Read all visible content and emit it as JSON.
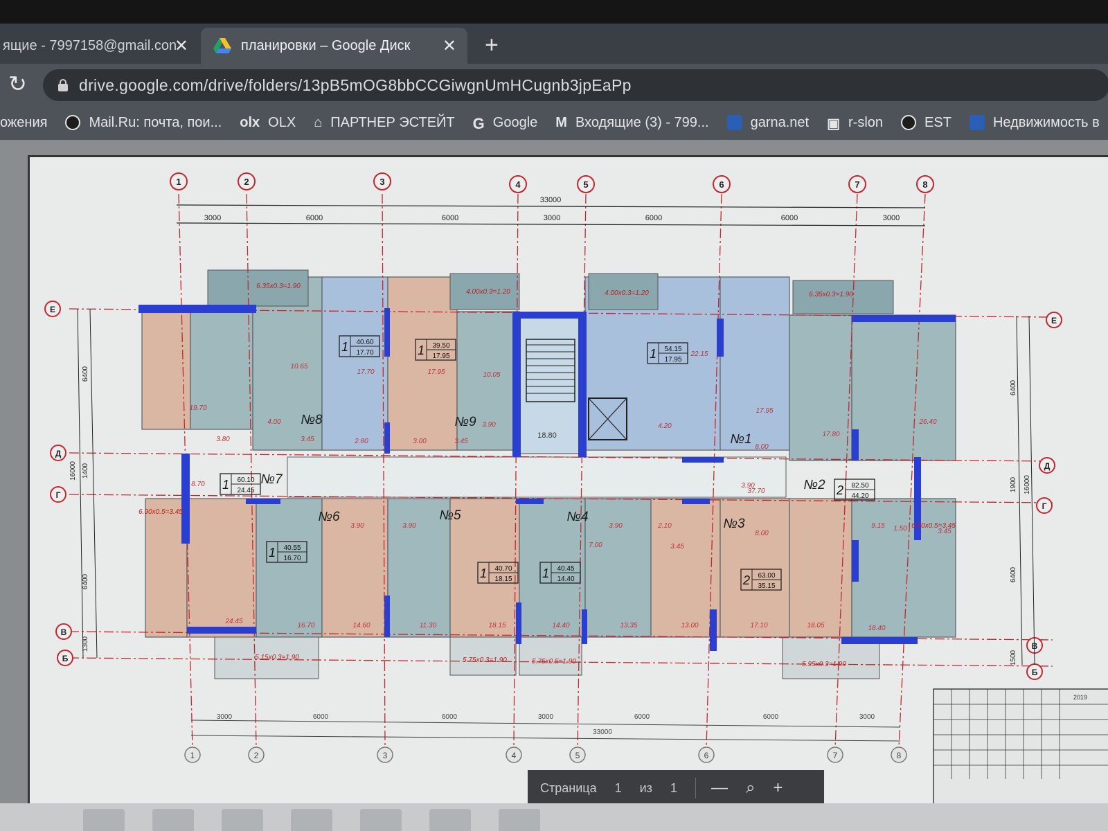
{
  "browser": {
    "tabs": [
      {
        "title": "ящие - 7997158@gmail.con",
        "active": false
      },
      {
        "title": "планировки – Google Диск",
        "active": true
      }
    ],
    "new_tab": "+",
    "close_glyph": "✕",
    "reload_glyph": "↻",
    "url": "drive.google.com/drive/folders/13pB5mOG8bbCCGiwgnUmHCugnb3jpEaPp"
  },
  "bookmarks": [
    {
      "label": "ожения",
      "icon": "none"
    },
    {
      "label": "Mail.Ru: почта, пои...",
      "icon": "globe-icon"
    },
    {
      "label": "OLX",
      "icon": "olx-icon"
    },
    {
      "label": "ПАРТНЕР ЭСТЕЙТ",
      "icon": "house-icon"
    },
    {
      "label": "Google",
      "icon": "google-icon"
    },
    {
      "label": "Входящие (3) - 799...",
      "icon": "gmail-icon"
    },
    {
      "label": "garna.net",
      "icon": "garna-icon"
    },
    {
      "label": "r-slon",
      "icon": "rslon-icon"
    },
    {
      "label": "EST",
      "icon": "globe-icon"
    },
    {
      "label": "Недвижимость в",
      "icon": "realty-icon"
    }
  ],
  "pdf_controls": {
    "page_label": "Страница",
    "current_page": "1",
    "of_label": "из",
    "total_pages": "1",
    "zoom_out": "—",
    "zoom_icon": "magnifier-icon",
    "zoom_in": "+"
  },
  "floorplan": {
    "axes_top": [
      "1",
      "2",
      "3",
      "4",
      "5",
      "6",
      "7",
      "8"
    ],
    "axes_side_left": [
      "Е",
      "Д",
      "Г",
      "В",
      "Б"
    ],
    "axes_side_right": [
      "Е",
      "Д",
      "Г",
      "В",
      "Б"
    ],
    "dim_spans_top": [
      "3000",
      "6000",
      "6000",
      "3000",
      "6000",
      "6000",
      "3000"
    ],
    "dim_total": "33000",
    "dim_spans_bottom": [
      "3000",
      "6000",
      "6000",
      "3000",
      "6000",
      "6000",
      "3000"
    ],
    "dim_total_bottom": "33000",
    "dim_left_segments": [
      "6400",
      "1400",
      "6400",
      "1300"
    ],
    "dim_left_total": "16000",
    "dim_right_segments": [
      "6400",
      "1900",
      "6400",
      "1500"
    ],
    "dim_right_total": "16000",
    "apartments": [
      {
        "no": "№8",
        "rooms": "1",
        "area": "40.60",
        "living": "17.70"
      },
      {
        "no": "№9",
        "rooms": "1",
        "area": "39.50",
        "living": "17.95"
      },
      {
        "no": "№1",
        "rooms": "1",
        "area": "54.15",
        "living": "17.95"
      },
      {
        "no": "№7",
        "rooms": "1",
        "area": "60.10",
        "living": "24.45"
      },
      {
        "no": "№2",
        "rooms": "2",
        "area": "82.50",
        "living": "44.20"
      },
      {
        "no": "№6",
        "rooms": "1",
        "area": "40.55",
        "living": "16.70"
      },
      {
        "no": "№5",
        "rooms": "1",
        "area": "40.70",
        "living": "18.15"
      },
      {
        "no": "№4",
        "rooms": "1",
        "area": "40.45",
        "living": "14.40"
      },
      {
        "no": "№3",
        "rooms": "2",
        "area": "63.00",
        "living": "35.15"
      }
    ],
    "balcony_labels_top": [
      "6.35x0.3=1.90",
      "4.00x0.3=1.20",
      "4.00x0.3=1.20",
      "6.35x0.3=1.90"
    ],
    "balcony_labels_bottom": [
      "5.15x0.3=1.90",
      "5.75x0.3=1.90",
      "5.75x0.5=1.90",
      "5.95x0.3=1.90"
    ],
    "side_balconies": [
      "6.90x0.5=3.45",
      "6.90x0.5=3.45"
    ],
    "room_areas": [
      "10.65",
      "17.70",
      "17.95",
      "19.70",
      "4.00",
      "3.80",
      "3.45",
      "2.80",
      "3.00",
      "10.05",
      "3.90",
      "3.45",
      "22.15",
      "4.20",
      "17.95",
      "8.00",
      "17.80",
      "26.40",
      "8.70",
      "3.90",
      "37.70",
      "9.15",
      "1.50",
      "3.45",
      "3.90",
      "3.90",
      "7.00",
      "3.90",
      "2.10",
      "3.45",
      "8.00",
      "24.45",
      "16.70",
      "14.60",
      "11.30",
      "18.15",
      "14.40",
      "13.35",
      "13.00",
      "17.10",
      "18.05",
      "18.40"
    ],
    "stair_label": "18.80",
    "colors": {
      "wall_blue": "#2a3fd0",
      "grid_red": "#c2272d",
      "room_teal": "#9fb9bd",
      "room_peach": "#d9b7a3",
      "room_blue": "#a9c0dc",
      "corridor": "#e6ecec"
    }
  },
  "title_block": {
    "year": "2019"
  }
}
